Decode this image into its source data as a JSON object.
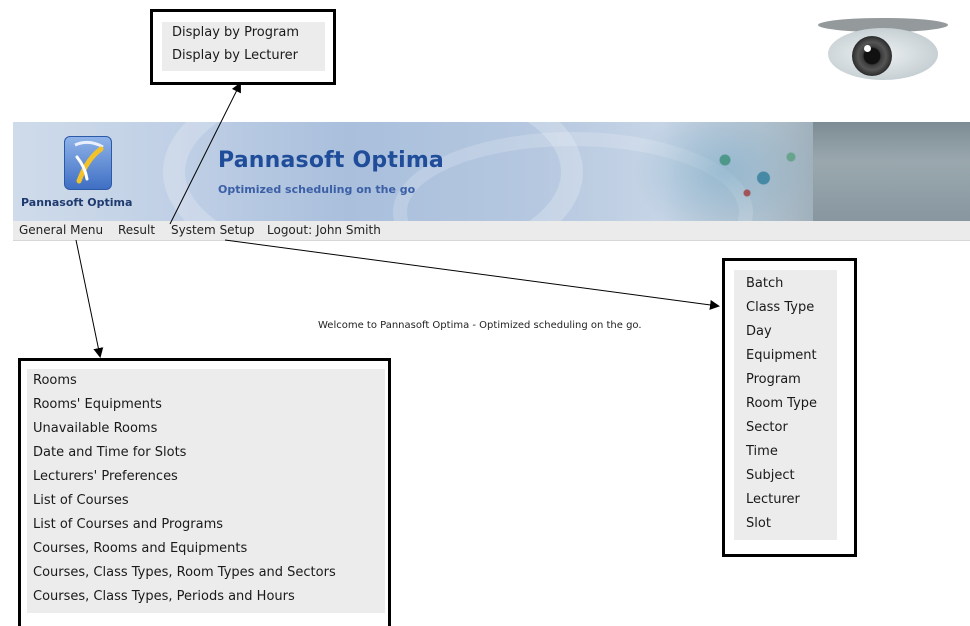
{
  "header": {
    "logo_caption": "Pannasoft Optima",
    "title": "Pannasoft Optima",
    "tagline": "Optimized scheduling on the go"
  },
  "menu": {
    "items": [
      {
        "label": "General Menu"
      },
      {
        "label": "Result"
      },
      {
        "label": "System Setup"
      },
      {
        "label": "Logout: John Smith"
      }
    ]
  },
  "welcome_text": "Welcome to Pannasoft Optima - Optimized scheduling on the go.",
  "result_menu": {
    "items": [
      "Display by Program",
      "Display by Lecturer"
    ]
  },
  "system_setup_menu": {
    "items": [
      "Batch",
      "Class Type",
      "Day",
      "Equipment",
      "Program",
      "Room Type",
      "Sector",
      "Time",
      "Subject",
      "Lecturer",
      "Slot"
    ]
  },
  "general_menu": {
    "items": [
      "Rooms",
      "Rooms' Equipments",
      "Unavailable Rooms",
      "Date and Time for Slots",
      "Lecturers' Preferences",
      "List of Courses",
      "List of Courses and Programs",
      "Courses, Rooms and Equipments",
      "Courses, Class Types, Room Types and Sectors",
      "Courses, Class Types, Periods and Hours"
    ]
  },
  "colors": {
    "menubar": "#ebebeb",
    "title_blue": "#1f4d9a",
    "callout_border": "#000000",
    "panel_bg": "#ececec"
  }
}
